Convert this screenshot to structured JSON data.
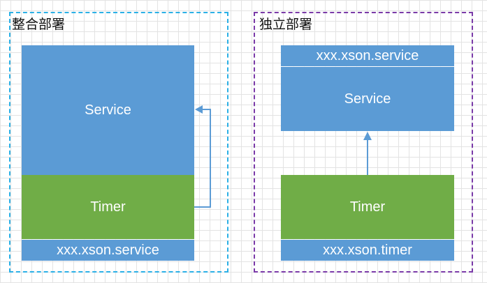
{
  "colors": {
    "integrated_border": "#2bb0e6",
    "standalone_border": "#7a3aa8",
    "blue_block": "#5b9bd5",
    "green_block": "#70ad47",
    "arrow": "#5b9bd5"
  },
  "integrated": {
    "title": "整合部署",
    "service_label": "Service",
    "timer_label": "Timer",
    "package_label": "xxx.xson.service"
  },
  "standalone": {
    "title": "独立部署",
    "service_package_label": "xxx.xson.service",
    "service_label": "Service",
    "timer_label": "Timer",
    "timer_package_label": "xxx.xson.timer"
  }
}
